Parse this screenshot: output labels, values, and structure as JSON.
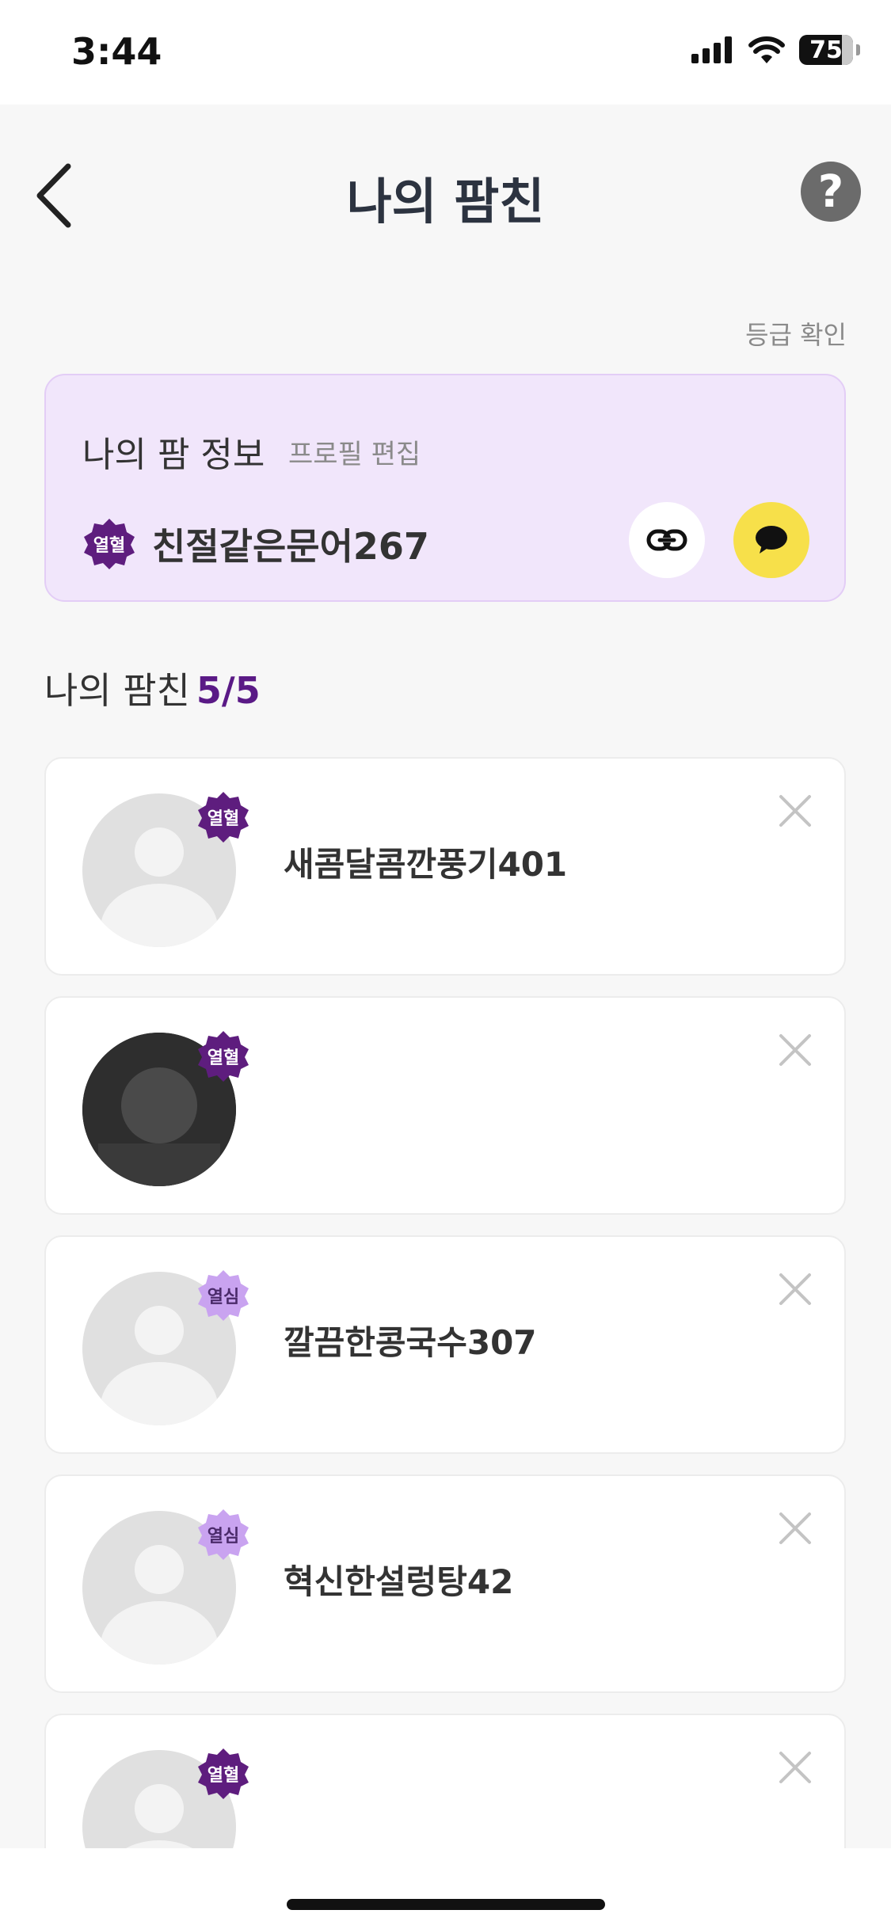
{
  "status_bar": {
    "time": "3:44",
    "battery_level": "75"
  },
  "nav": {
    "title": "나의 팜친",
    "help_label": "?"
  },
  "grade_link": "등급 확인",
  "my_info": {
    "title": "나의 팜 정보",
    "edit_label": "프로필 편집",
    "badge": "열혈",
    "name": "친절같은문어267"
  },
  "friends_section": {
    "label": "나의 팜친",
    "count": "5/5"
  },
  "friends": [
    {
      "badge": "열혈",
      "badge_tier": "dark",
      "name": "새콤달콤깐풍기401"
    },
    {
      "badge": "열혈",
      "badge_tier": "dark",
      "name": ""
    },
    {
      "badge": "열심",
      "badge_tier": "light",
      "name": "깔끔한콩국수307"
    },
    {
      "badge": "열심",
      "badge_tier": "light",
      "name": "혁신한설렁탕42"
    },
    {
      "badge": "열혈",
      "badge_tier": "dark",
      "name": ""
    }
  ],
  "colors": {
    "accent_purple": "#5a1a86",
    "badge_dark": "#5e1d7e",
    "badge_light": "#c9a3f0",
    "info_card_bg": "#f1e6fb",
    "kakao_yellow": "#f7e04a"
  }
}
